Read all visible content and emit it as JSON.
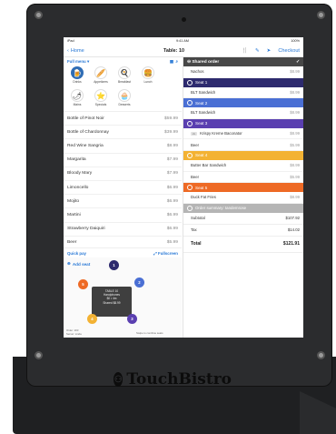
{
  "status_bar": {
    "carrier": "iPad",
    "time": "9:41 AM",
    "battery": "100%"
  },
  "nav": {
    "back_label": "Home",
    "title": "Table: 10",
    "checkout_label": "Checkout"
  },
  "menu": {
    "dropdown_label": "Full menu",
    "categories": [
      {
        "label": "Drinks",
        "icon": "beer-mug-icon",
        "color": "#2f6db5",
        "glyph": "🍺"
      },
      {
        "label": "Appetizers",
        "icon": "bread-icon",
        "color": "#ffffff",
        "glyph": "🥖"
      },
      {
        "label": "Breakfast",
        "icon": "egg-icon",
        "color": "#ffffff",
        "glyph": "🍳"
      },
      {
        "label": "Lunch",
        "icon": "burger-icon",
        "color": "#ffffff",
        "glyph": "🍔"
      },
      {
        "label": "Mains",
        "icon": "chili-pepper-icon",
        "color": "#ffffff",
        "glyph": "🌶"
      },
      {
        "label": "Specials",
        "icon": "star-icon",
        "color": "#ffffff",
        "glyph": "⭐"
      },
      {
        "label": "Desserts",
        "icon": "cupcake-icon",
        "color": "#ffffff",
        "glyph": "🧁"
      }
    ],
    "items": [
      {
        "name": "Bottle of Pinot Noir",
        "price": "$59.99"
      },
      {
        "name": "Bottle of Chardonnay",
        "price": "$39.99"
      },
      {
        "name": "Red Wine Sangria",
        "price": "$8.99"
      },
      {
        "name": "Margarita",
        "price": "$7.99"
      },
      {
        "name": "Bloody Mary",
        "price": "$7.99"
      },
      {
        "name": "Limoncello",
        "price": "$6.99"
      },
      {
        "name": "Mojito",
        "price": "$6.99"
      },
      {
        "name": "Martini",
        "price": "$6.99"
      },
      {
        "name": "Strawberry Daiquiri",
        "price": "$6.99"
      },
      {
        "name": "Beer",
        "price": "$5.99"
      }
    ]
  },
  "quick": {
    "quick_pay": "Quick pay",
    "fullscreen": "Fullscreen"
  },
  "seats_panel": {
    "add_seat": "Add seat",
    "bubbles": [
      {
        "label": "1",
        "color": "#2d2a6e"
      },
      {
        "label": "2",
        "color": "#4a6fd4"
      },
      {
        "label": "3",
        "color": "#5a3fb0"
      },
      {
        "label": "4",
        "color": "#f3b233"
      },
      {
        "label": "5",
        "color": "#ee6a25"
      }
    ],
    "table_card": {
      "title": "TABLE 10",
      "line1": "Handphones",
      "line2": "$0 • 4m",
      "line3": "Shared $8.99"
    },
    "footer_left": "Order: 203\nServer: Linda",
    "footer_right": "Swipe to combine seats"
  },
  "order": {
    "shared": {
      "title": "Shared order",
      "items": [
        {
          "name": "Nachos",
          "price": "$8.99"
        }
      ]
    },
    "seats": [
      {
        "title": "Seat 1",
        "color": "#2d2a6e",
        "items": [
          {
            "name": "BLT Sandwich",
            "price": "$8.99",
            "tag": ""
          }
        ]
      },
      {
        "title": "Seat 2",
        "color": "#4a6fd4",
        "items": [
          {
            "name": "BLT Sandwich",
            "price": "$8.99",
            "tag": ""
          }
        ]
      },
      {
        "title": "Seat 3",
        "color": "#5a3fb0",
        "items": [
          {
            "name": "Krispy Kreme Baconator",
            "price": "$8.99",
            "tag": "2x"
          },
          {
            "name": "Beer",
            "price": "$5.99",
            "tag": ""
          }
        ]
      },
      {
        "title": "Seat 4",
        "color": "#f3b233",
        "items": [
          {
            "name": "Butter Bar Sandwich",
            "price": "$8.99",
            "tag": ""
          },
          {
            "name": "Beer",
            "price": "$5.99",
            "tag": ""
          }
        ]
      },
      {
        "title": "Seat 5",
        "color": "#ee6a25",
        "items": [
          {
            "name": "Duck Fat Fries",
            "price": "$8.99",
            "tag": ""
          }
        ]
      }
    ],
    "summary": {
      "title": "Order summary: tandemrose",
      "subtotal_label": "Subtotal",
      "subtotal": "$107.92",
      "tax_label": "Tax",
      "tax": "$14.02",
      "total_label": "Total",
      "total": "$121.91"
    }
  },
  "brand": {
    "name": "TouchBistro"
  }
}
